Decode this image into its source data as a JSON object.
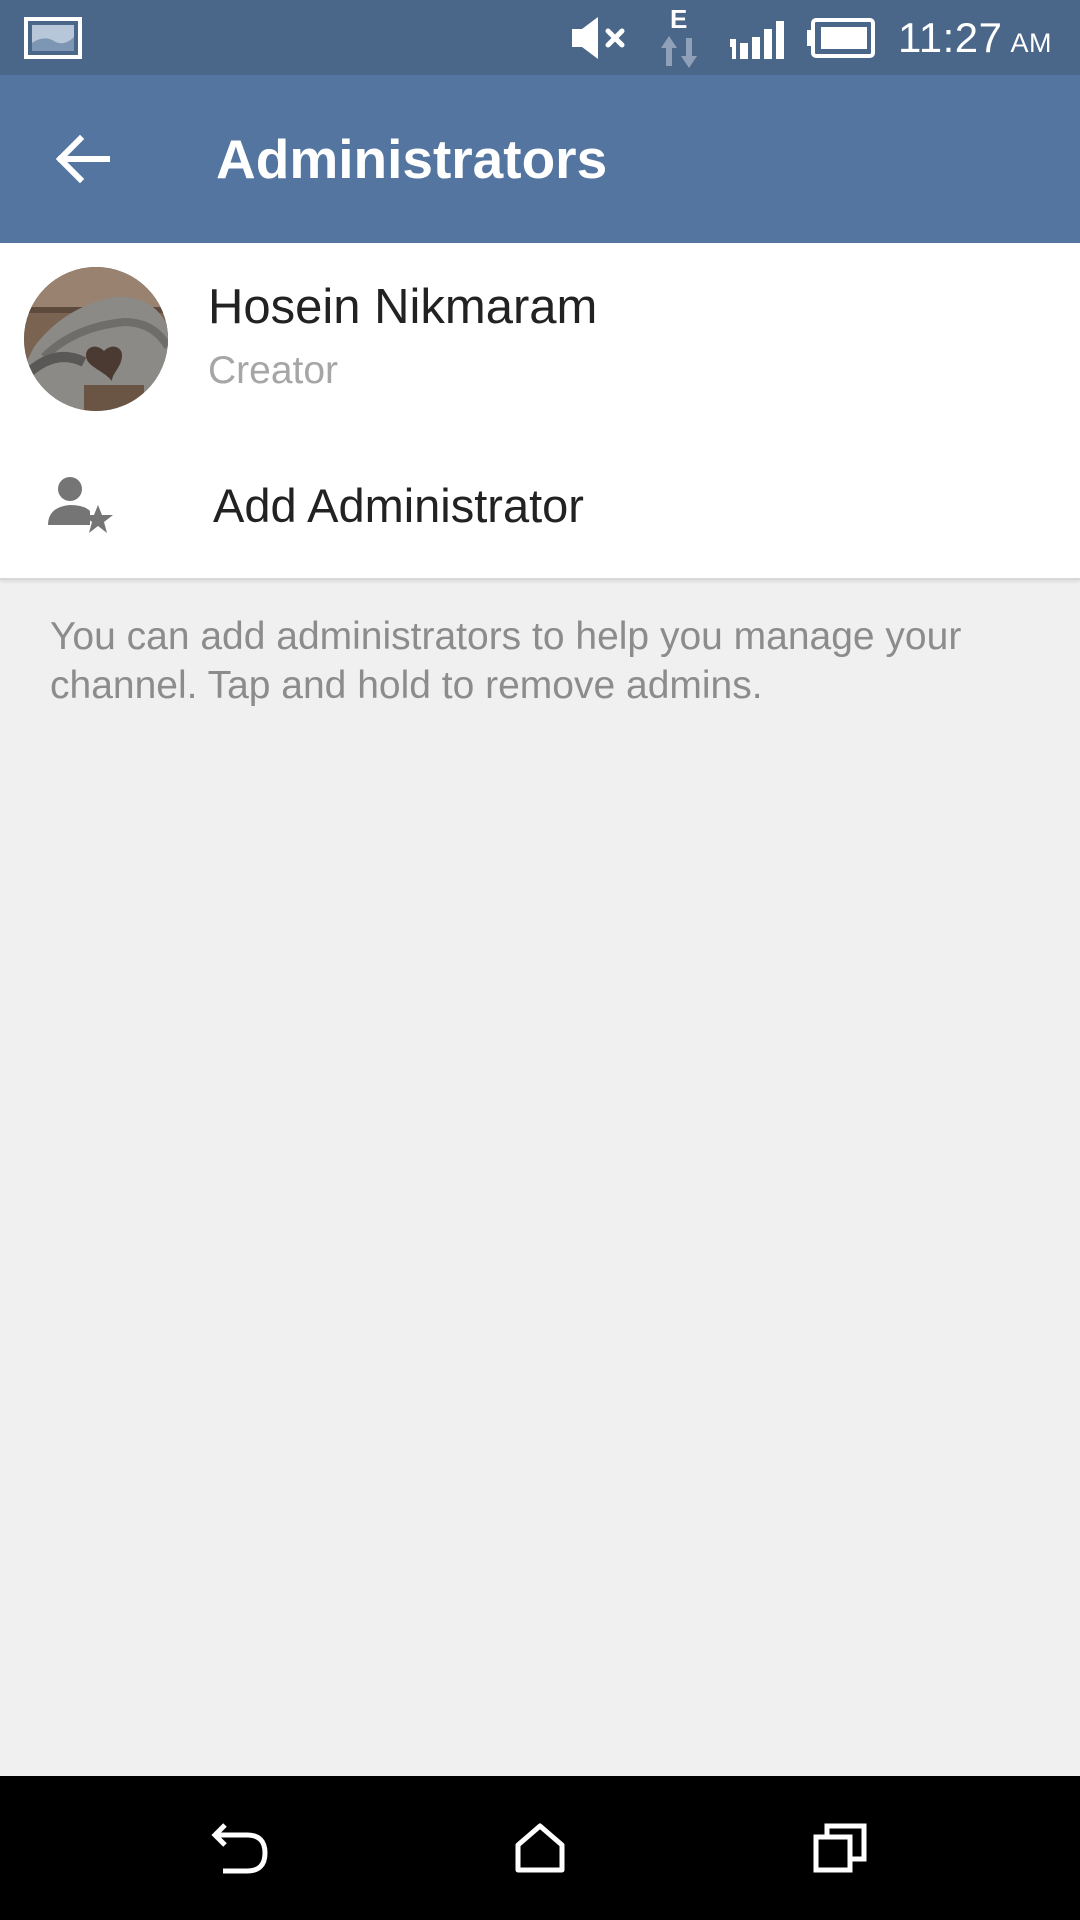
{
  "status_bar": {
    "time": "11:27",
    "ampm": "AM",
    "network_type": "E",
    "icons": [
      "gallery-icon",
      "mute-icon",
      "data-arrows-icon",
      "signal-icon",
      "battery-icon"
    ]
  },
  "toolbar": {
    "title": "Administrators",
    "back_icon": "arrow-left-icon"
  },
  "admins": [
    {
      "name": "Hosein Nikmaram",
      "role": "Creator"
    }
  ],
  "add_admin": {
    "label": "Add Administrator",
    "icon": "add-admin-icon"
  },
  "info": {
    "text": "You can add administrators to help you manage your channel. Tap and hold to remove admins."
  },
  "nav_bar": {
    "icons": [
      "back-icon",
      "home-icon",
      "recents-icon"
    ]
  },
  "colors": {
    "status_bar": "#4a6689",
    "toolbar": "#5475a0",
    "background": "#f0f0f0",
    "card": "#ffffff",
    "primary_text": "#222222",
    "secondary_text": "#a6a6a6",
    "info_text": "#8c8c8c",
    "icon_gray": "#757575"
  }
}
